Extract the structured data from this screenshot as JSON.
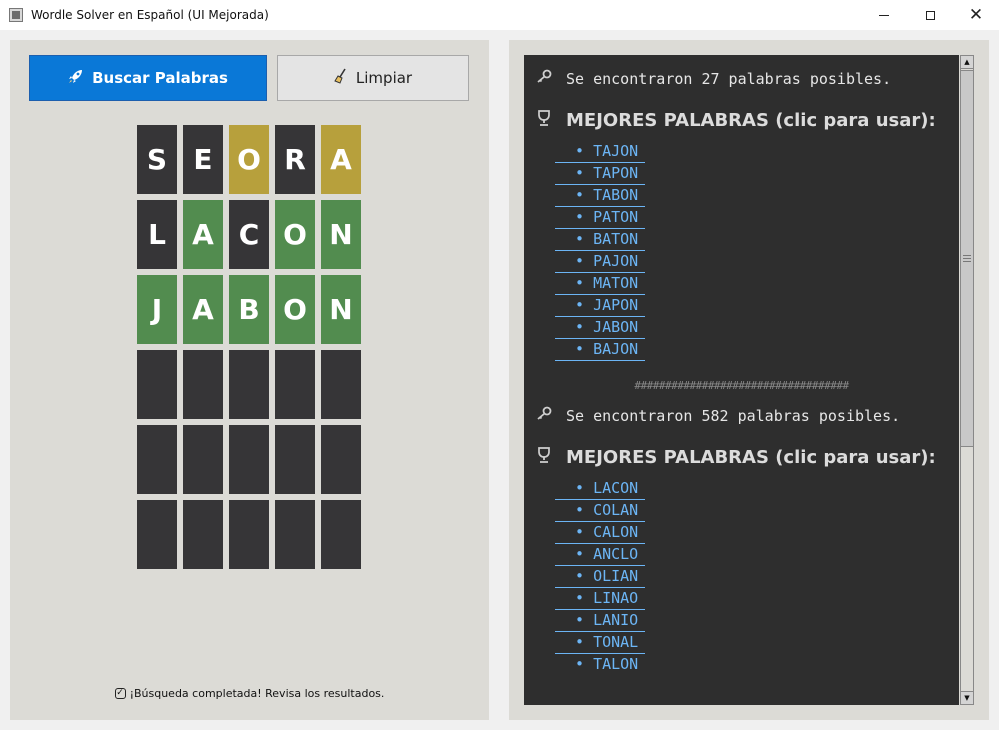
{
  "window": {
    "title": "Wordle Solver en Español (UI Mejorada)",
    "minimize": "",
    "maximize": "",
    "close": "✕"
  },
  "toolbar": {
    "search_label": "Buscar Palabras",
    "search_icon": "rocket-icon",
    "clear_label": "Limpiar",
    "clear_icon": "broom-icon",
    "accent_color": "#0a78d7"
  },
  "board": {
    "rows": [
      [
        {
          "letter": "S",
          "state": "absent"
        },
        {
          "letter": "E",
          "state": "absent"
        },
        {
          "letter": "O",
          "state": "present"
        },
        {
          "letter": "R",
          "state": "absent"
        },
        {
          "letter": "A",
          "state": "present"
        }
      ],
      [
        {
          "letter": "L",
          "state": "absent"
        },
        {
          "letter": "A",
          "state": "correct"
        },
        {
          "letter": "C",
          "state": "absent"
        },
        {
          "letter": "O",
          "state": "correct"
        },
        {
          "letter": "N",
          "state": "correct"
        }
      ],
      [
        {
          "letter": "J",
          "state": "correct"
        },
        {
          "letter": "A",
          "state": "correct"
        },
        {
          "letter": "B",
          "state": "correct"
        },
        {
          "letter": "O",
          "state": "correct"
        },
        {
          "letter": "N",
          "state": "correct"
        }
      ],
      [
        {
          "letter": "",
          "state": "empty"
        },
        {
          "letter": "",
          "state": "empty"
        },
        {
          "letter": "",
          "state": "empty"
        },
        {
          "letter": "",
          "state": "empty"
        },
        {
          "letter": "",
          "state": "empty"
        }
      ],
      [
        {
          "letter": "",
          "state": "empty"
        },
        {
          "letter": "",
          "state": "empty"
        },
        {
          "letter": "",
          "state": "empty"
        },
        {
          "letter": "",
          "state": "empty"
        },
        {
          "letter": "",
          "state": "empty"
        }
      ],
      [
        {
          "letter": "",
          "state": "empty"
        },
        {
          "letter": "",
          "state": "empty"
        },
        {
          "letter": "",
          "state": "empty"
        },
        {
          "letter": "",
          "state": "empty"
        },
        {
          "letter": "",
          "state": "empty"
        }
      ]
    ],
    "colors": {
      "absent": "#363537",
      "present": "#b7a03c",
      "correct": "#528c4f"
    }
  },
  "status": {
    "icon": "checkbox-icon",
    "text": "¡Búsqueda completada! Revisa los resultados."
  },
  "results": {
    "blocks": [
      {
        "found_text": "Se encontraron 27 palabras posibles.",
        "best_title": "MEJORES PALABRAS (clic para usar):",
        "words": [
          "TAJON",
          "TAPON",
          "TABON",
          "PATON",
          "BATON",
          "PAJON",
          "MATON",
          "JAPON",
          "JABON",
          "BAJON"
        ]
      },
      {
        "found_text": "Se encontraron 582 palabras posibles.",
        "best_title": "MEJORES PALABRAS (clic para usar):",
        "words": [
          "LACON",
          "COLAN",
          "CALON",
          "ANCLO",
          "OLIAN",
          "LINAO",
          "LANIO",
          "TONAL",
          "TALON"
        ]
      }
    ],
    "divider": "###################################",
    "bullet": "•",
    "found_icon": "key-icon",
    "best_icon": "trophy-icon",
    "link_color": "#6cb5f5"
  }
}
